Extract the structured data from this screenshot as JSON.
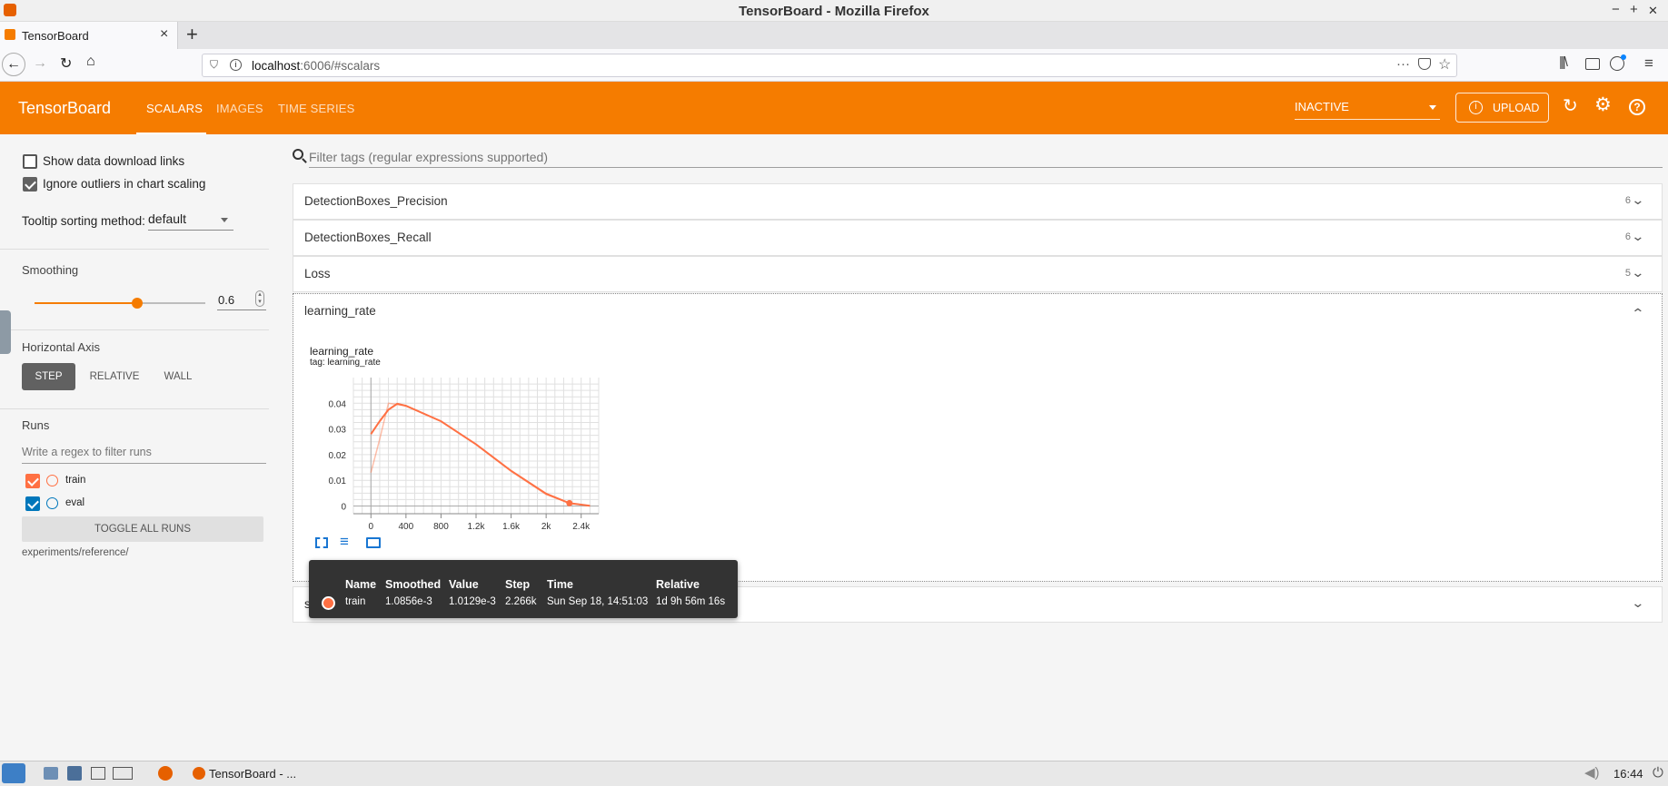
{
  "window": {
    "title": "TensorBoard - Mozilla Firefox",
    "min": "−",
    "max": "+",
    "close": "✕"
  },
  "browser": {
    "tab_title": "TensorBoard",
    "url_host": "localhost",
    "url_rest": ":6006/#scalars"
  },
  "header": {
    "brand": "TensorBoard",
    "nav": [
      "SCALARS",
      "IMAGES",
      "TIME SERIES"
    ],
    "active_nav": "SCALARS",
    "status_select": "INACTIVE",
    "upload_label": "UPLOAD"
  },
  "sidebar": {
    "show_download_links": "Show data download links",
    "ignore_outliers": "Ignore outliers in chart scaling",
    "tooltip_sorting_label": "Tooltip sorting method:",
    "tooltip_sorting_value": "default",
    "smoothing_label": "Smoothing",
    "smoothing_value": "0.6",
    "smoothing_fraction": 0.6,
    "horizontal_axis_label": "Horizontal Axis",
    "axis_options": [
      "STEP",
      "RELATIVE",
      "WALL"
    ],
    "runs_label": "Runs",
    "runs_filter_placeholder": "Write a regex to filter runs",
    "runs": [
      {
        "name": "train",
        "color": "#ff7043"
      },
      {
        "name": "eval",
        "color": "#0077bb"
      }
    ],
    "toggle_all_runs": "TOGGLE ALL RUNS",
    "logdir": "experiments/reference/"
  },
  "main": {
    "filter_placeholder": "Filter tags (regular expressions supported)",
    "panes": [
      {
        "name": "DetectionBoxes_Precision",
        "count": "6"
      },
      {
        "name": "DetectionBoxes_Recall",
        "count": "6"
      },
      {
        "name": "Loss",
        "count": "5"
      },
      {
        "name": "learning_rate",
        "count": ""
      },
      {
        "name": "steps_per_sec",
        "count": ""
      }
    ]
  },
  "card": {
    "title": "learning_rate",
    "tag": "tag: learning_rate"
  },
  "tooltip": {
    "headers": [
      "Name",
      "Smoothed",
      "Value",
      "Step",
      "Time",
      "Relative"
    ],
    "row": {
      "name": "train",
      "smoothed": "1.0856e-3",
      "value": "1.0129e-3",
      "step": "2.266k",
      "time": "Sun Sep 18, 14:51:03",
      "relative": "1d 9h 56m 16s"
    }
  },
  "chart_data": {
    "type": "line",
    "title": "learning_rate",
    "x_ticks": [
      "0",
      "400",
      "800",
      "1.2k",
      "1.6k",
      "2k",
      "2.4k"
    ],
    "y_ticks": [
      "0",
      "0.01",
      "0.02",
      "0.03",
      "0.04"
    ],
    "xlim": [
      -200,
      2600
    ],
    "ylim": [
      -0.003,
      0.05
    ],
    "grid": true,
    "series": [
      {
        "name": "train",
        "color": "#ff7043",
        "raw": [
          [
            0,
            0.013
          ],
          [
            100,
            0.026
          ],
          [
            200,
            0.04
          ],
          [
            400,
            0.039
          ],
          [
            800,
            0.033
          ],
          [
            1200,
            0.024
          ],
          [
            1600,
            0.0135
          ],
          [
            2000,
            0.0045
          ],
          [
            2266,
            0.0011
          ],
          [
            2500,
            0.0
          ]
        ],
        "smoothed": [
          [
            0,
            0.028
          ],
          [
            100,
            0.033
          ],
          [
            200,
            0.0375
          ],
          [
            300,
            0.0398
          ],
          [
            400,
            0.039
          ],
          [
            800,
            0.033
          ],
          [
            1200,
            0.024
          ],
          [
            1600,
            0.0137
          ],
          [
            2000,
            0.0048
          ],
          [
            2266,
            0.0011
          ],
          [
            2500,
            0.0001
          ]
        ]
      }
    ]
  },
  "taskbar": {
    "task_label": "TensorBoard - ...",
    "clock": "16:44"
  }
}
